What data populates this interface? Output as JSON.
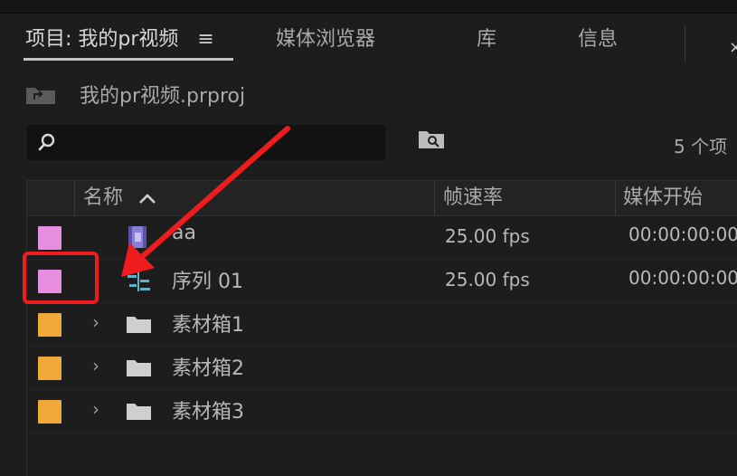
{
  "tabs": [
    {
      "label": "项目: 我的pr视频",
      "active": true
    },
    {
      "label": "媒体浏览器",
      "active": false
    },
    {
      "label": "库",
      "active": false
    },
    {
      "label": "信息",
      "active": false
    }
  ],
  "tab_menu_glyph": "≡",
  "close_glyph": "×",
  "project": {
    "name": "我的pr视频.prproj"
  },
  "search": {
    "value": "",
    "placeholder": ""
  },
  "item_count": "5 个项",
  "columns": {
    "name": "名称",
    "frame_rate": "帧速率",
    "media_start": "媒体开始"
  },
  "rows": [
    {
      "name": "aa",
      "type": "video-clip",
      "label_color": "#e88ee0",
      "frame_rate": "25.00 fps",
      "media_start": "00:00:00:00",
      "expandable": false
    },
    {
      "name": "序列 01",
      "type": "sequence",
      "label_color": "#e88ee0",
      "frame_rate": "25.00 fps",
      "media_start": "00:00:00:00",
      "expandable": false
    },
    {
      "name": "素材箱1",
      "type": "bin",
      "label_color": "#f0a838",
      "frame_rate": "",
      "media_start": "",
      "expandable": true
    },
    {
      "name": "素材箱2",
      "type": "bin",
      "label_color": "#f0a838",
      "frame_rate": "",
      "media_start": "",
      "expandable": true
    },
    {
      "name": "素材箱3",
      "type": "bin",
      "label_color": "#f0a838",
      "frame_rate": "",
      "media_start": "",
      "expandable": true
    }
  ],
  "chevron_glyph": "›",
  "colors": {
    "annotation": "#ee1c1c",
    "sequence_icon": "#5fb2c8",
    "clip_icon": "#8a7fd6",
    "bin_icon": "#cfcfcf"
  }
}
